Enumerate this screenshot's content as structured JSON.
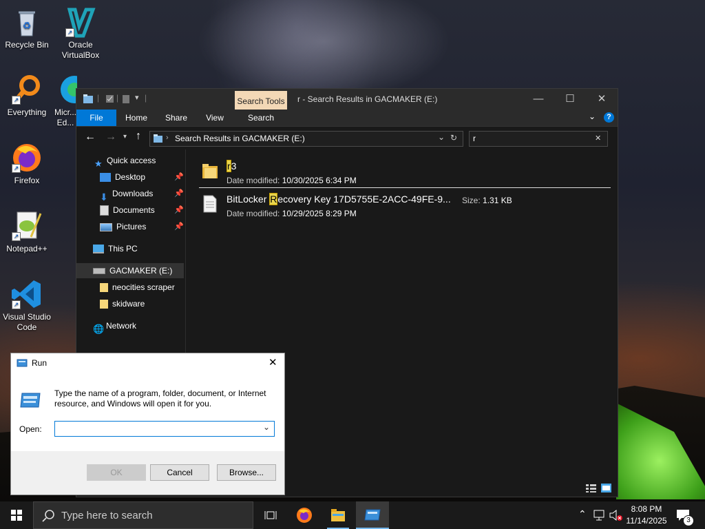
{
  "desktop": {
    "icons": [
      {
        "label": "Recycle Bin"
      },
      {
        "label": "Oracle VirtualBox"
      },
      {
        "label": "Everything"
      },
      {
        "label": "Micr... Ed..."
      },
      {
        "label": "Firefox"
      },
      {
        "label": "Notepad++"
      },
      {
        "label": "Visual Studio Code"
      }
    ]
  },
  "explorer": {
    "title": "r - Search Results in GACMAKER (E:)",
    "contextual_tab": "Search Tools",
    "ribbon_tabs": [
      "File",
      "Home",
      "Share",
      "View",
      "Search"
    ],
    "address": "Search Results in GACMAKER (E:)",
    "search_value": "r",
    "nav": {
      "quick_access": "Quick access",
      "desktop": "Desktop",
      "downloads": "Downloads",
      "documents": "Documents",
      "pictures": "Pictures",
      "this_pc": "This PC",
      "drive": "GACMAKER (E:)",
      "folder1": "neocities scraper",
      "folder2": "skidware",
      "network": "Network"
    },
    "results": [
      {
        "name_hl": "r",
        "name_rest": "3",
        "name_pre": "",
        "meta_label": "Date modified:",
        "meta_value": "10/30/2025 6:34 PM",
        "size_label": "",
        "size_value": ""
      },
      {
        "name_pre": "BitLocker ",
        "name_hl": "R",
        "name_rest": "ecovery Key 17D5755E-2ACC-49FE-9...",
        "meta_label": "Date modified:",
        "meta_value": "10/29/2025 8:29 PM",
        "size_label": "Size:",
        "size_value": "1.31 KB"
      }
    ]
  },
  "run": {
    "title": "Run",
    "description": "Type the name of a program, folder, document, or Internet resource, and Windows will open it for you.",
    "open_label": "Open:",
    "open_value": "",
    "ok": "OK",
    "cancel": "Cancel",
    "browse": "Browse..."
  },
  "taskbar": {
    "search_placeholder": "Type here to search",
    "time": "8:08 PM",
    "date": "11/14/2025",
    "notification_count": "3"
  },
  "colors": {
    "accent": "#0078d7",
    "highlight": "#e8d44d",
    "contextual_tab": "#f3d8b6"
  }
}
